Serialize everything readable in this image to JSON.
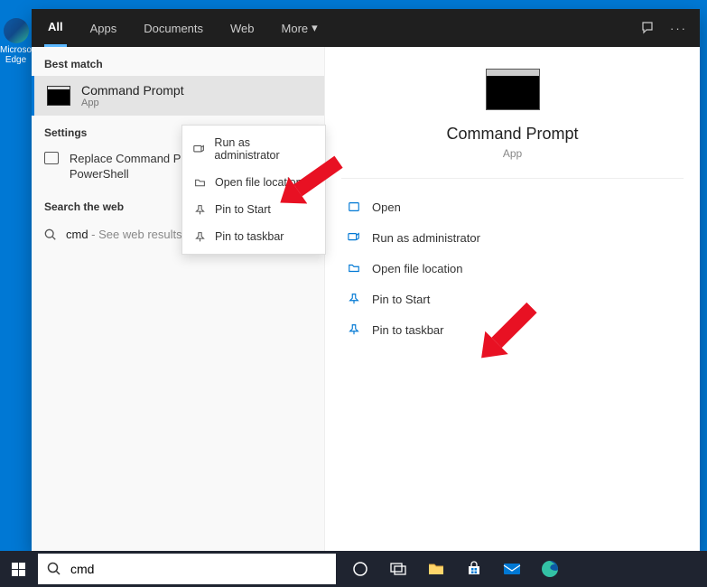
{
  "desktop": {
    "edge_label": "Microsoft Edge"
  },
  "tabs": {
    "all": "All",
    "apps": "Apps",
    "documents": "Documents",
    "web": "Web",
    "more": "More"
  },
  "left": {
    "best_match": "Best match",
    "result_title": "Command Prompt",
    "result_sub": "App",
    "settings_header": "Settings",
    "settings_item": "Replace Command Prompt with Windows PowerShell",
    "search_web_header": "Search the web",
    "web_query": "cmd",
    "web_hint": " - See web results"
  },
  "context_menu": {
    "run_admin": "Run as administrator",
    "open_location": "Open file location",
    "pin_start": "Pin to Start",
    "pin_taskbar": "Pin to taskbar"
  },
  "detail": {
    "title": "Command Prompt",
    "sub": "App",
    "open": "Open",
    "run_admin": "Run as administrator",
    "open_location": "Open file location",
    "pin_start": "Pin to Start",
    "pin_taskbar": "Pin to taskbar"
  },
  "taskbar": {
    "search_value": "cmd"
  }
}
